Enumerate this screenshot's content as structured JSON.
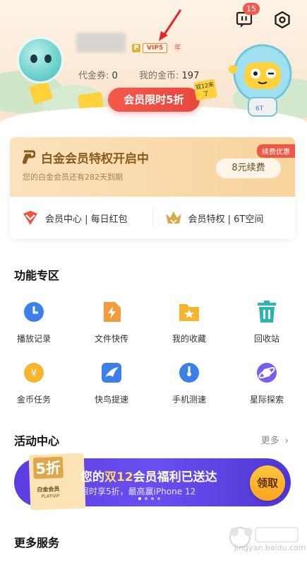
{
  "header": {
    "notification_count": "15",
    "vip_level": "VIP5",
    "vip_icon_letter": "P",
    "year_tag": "年",
    "voucher_label": "代金券:",
    "voucher_value": "0",
    "coins_label": "我的金币:",
    "coins_value": "197",
    "promo_button": "会员限时5折",
    "sticker_text": "双12来了"
  },
  "platinum": {
    "title": "白金会员特权开启中",
    "subtitle": "您的白金会员还有282天到期",
    "renew_tag": "续费优惠",
    "renew_button": "8元续费",
    "links": [
      {
        "label": "会员中心 | 每日红包",
        "icon": "red-envelope-icon"
      },
      {
        "label": "会员特权 | 6T空间",
        "icon": "crown-icon"
      }
    ]
  },
  "functions": {
    "title": "功能专区",
    "items": [
      {
        "label": "播放记录",
        "icon": "clock-icon",
        "color": "#3d7fe8"
      },
      {
        "label": "文件快传",
        "icon": "lightning-file-icon",
        "color": "#f39a3a"
      },
      {
        "label": "我的收藏",
        "icon": "star-folder-icon",
        "color": "#f5b52e"
      },
      {
        "label": "回收站",
        "icon": "trash-icon",
        "color": "#2cb5b0"
      },
      {
        "label": "金币任务",
        "icon": "coin-icon",
        "color": "#f5b52e"
      },
      {
        "label": "快鸟提速",
        "icon": "bird-icon",
        "color": "#3d7fe8"
      },
      {
        "label": "手机测速",
        "icon": "speedometer-icon",
        "color": "#3d7fe8"
      },
      {
        "label": "星际探索",
        "icon": "planet-icon",
        "color": "#7b5cf0"
      }
    ]
  },
  "activity": {
    "title": "活动中心",
    "more": "更多",
    "banner": {
      "discount": "5折",
      "card_label": "白金会员",
      "card_label_en": "PLATIVIP",
      "title_prefix": "您的",
      "title_highlight": "双12",
      "title_suffix": "会员福利已送达",
      "subtitle": "限时享5折，最高赢iPhone 12",
      "button": "领取"
    }
  },
  "more_services": {
    "title": "更多服务"
  },
  "watermark": {
    "text": "jingyan.baidu.com"
  },
  "colors": {
    "accent_red": "#e8473d",
    "banner_purple": "#5b3de0",
    "gold": "#f8d39d"
  }
}
